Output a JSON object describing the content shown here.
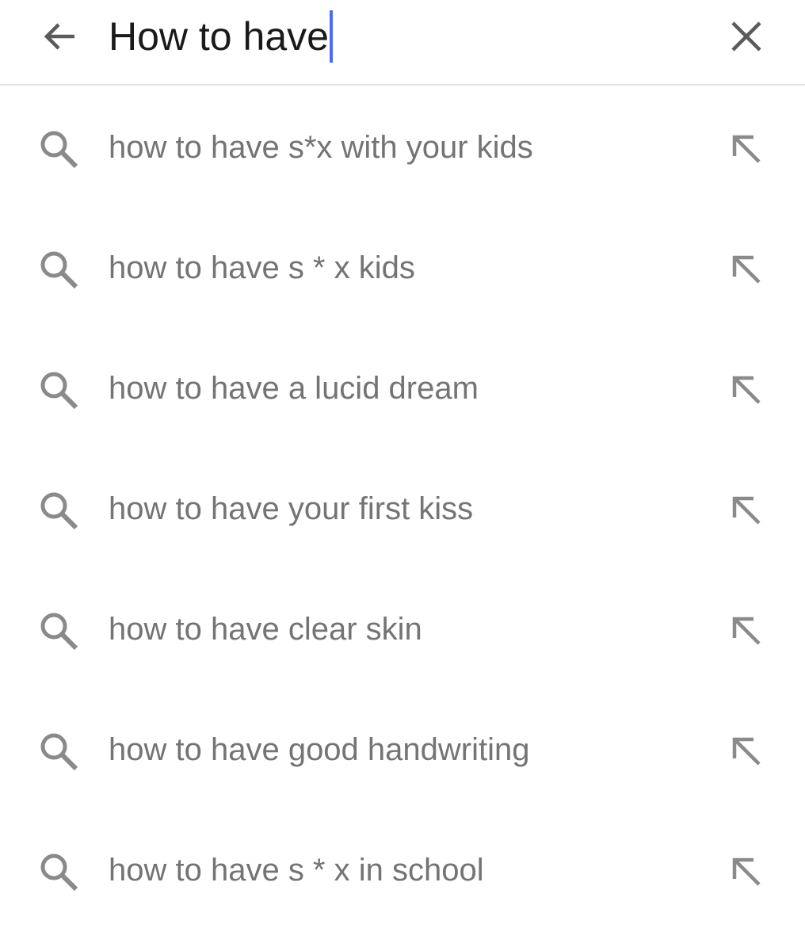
{
  "colors": {
    "query_text": "#1a1a1a",
    "suggestion_text": "#747474",
    "icon_gray": "#8a8a8a",
    "header_icon": "#5a5a5a",
    "caret": "#4a6cf7",
    "divider": "#e4e4e4"
  },
  "header": {
    "back_icon": "arrow-left-icon",
    "clear_icon": "close-icon"
  },
  "search": {
    "query": "How to have"
  },
  "suggestions": [
    {
      "text": "how to have s*x with your kids",
      "icon": "search-icon",
      "action_icon": "arrow-up-left-icon"
    },
    {
      "text": "how to have s * x kids",
      "icon": "search-icon",
      "action_icon": "arrow-up-left-icon"
    },
    {
      "text": "how to have a lucid dream",
      "icon": "search-icon",
      "action_icon": "arrow-up-left-icon"
    },
    {
      "text": "how to have your first kiss",
      "icon": "search-icon",
      "action_icon": "arrow-up-left-icon"
    },
    {
      "text": "how to have clear skin",
      "icon": "search-icon",
      "action_icon": "arrow-up-left-icon"
    },
    {
      "text": "how to have good handwriting",
      "icon": "search-icon",
      "action_icon": "arrow-up-left-icon"
    },
    {
      "text": "how to have s * x in school",
      "icon": "search-icon",
      "action_icon": "arrow-up-left-icon"
    }
  ]
}
